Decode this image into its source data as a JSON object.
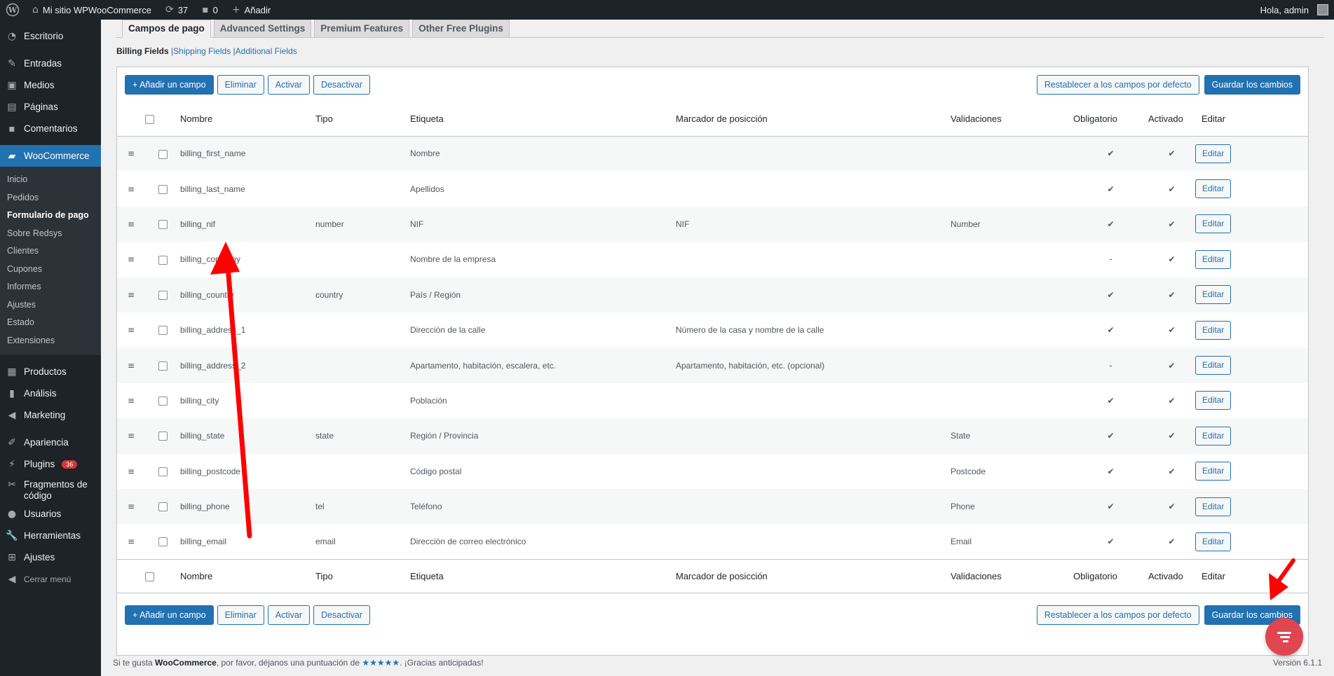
{
  "adminbar": {
    "site_name": "Mi sitio WPWooCommerce",
    "updates": "37",
    "comments": "0",
    "new_label": "Añadir",
    "greeting": "Hola, admin"
  },
  "sidebar": {
    "dashboard": "Escritorio",
    "posts": "Entradas",
    "media": "Medios",
    "pages": "Páginas",
    "comments": "Comentarios",
    "woocommerce": "WooCommerce",
    "woo_sub": [
      "Inicio",
      "Pedidos",
      "Formulario de pago",
      "Sobre Redsys",
      "Clientes",
      "Cupones",
      "Informes",
      "Ajustes",
      "Estado",
      "Extensiones"
    ],
    "products": "Productos",
    "analytics": "Análisis",
    "marketing": "Marketing",
    "appearance": "Apariencia",
    "plugins": "Plugins",
    "plugins_badge": "36",
    "snippets_1": "Fragmentos de",
    "snippets_2": "código",
    "users": "Usuarios",
    "tools": "Herramientas",
    "settings": "Ajustes",
    "collapse": "Cerrar menú"
  },
  "tabs": [
    "Campos de pago",
    "Advanced Settings",
    "Premium Features",
    "Other Free Plugins"
  ],
  "subnav": {
    "billing": "Billing Fields",
    "shipping": "Shipping Fields",
    "additional": "Additional Fields",
    "separator": "|"
  },
  "toolbar": {
    "add": "+ Añadir un campo",
    "delete": "Eliminar",
    "enable": "Activar",
    "disable": "Desactivar",
    "reset": "Restablecer a los campos por defecto",
    "save": "Guardar los cambios"
  },
  "columns": {
    "name": "Nombre",
    "type": "Tipo",
    "label": "Etiqueta",
    "placeholder": "Marcador de posicción",
    "validations": "Validaciones",
    "required": "Obligatorio",
    "enabled": "Activado",
    "edit": "Editar"
  },
  "rows": [
    {
      "name": "billing_first_name",
      "type": "",
      "label": "Nombre",
      "placeholder": "",
      "validation": "",
      "required": "✔",
      "enabled": "✔",
      "edit": "Editar"
    },
    {
      "name": "billing_last_name",
      "type": "",
      "label": "Apellidos",
      "placeholder": "",
      "validation": "",
      "required": "✔",
      "enabled": "✔",
      "edit": "Editar"
    },
    {
      "name": "billing_nif",
      "type": "number",
      "label": "NIF",
      "placeholder": "NIF",
      "validation": "Number",
      "required": "✔",
      "enabled": "✔",
      "edit": "Editar"
    },
    {
      "name": "billing_company",
      "type": "",
      "label": "Nombre de la empresa",
      "placeholder": "",
      "validation": "",
      "required": "-",
      "enabled": "✔",
      "edit": "Editar"
    },
    {
      "name": "billing_country",
      "type": "country",
      "label": "País / Región",
      "placeholder": "",
      "validation": "",
      "required": "✔",
      "enabled": "✔",
      "edit": "Editar"
    },
    {
      "name": "billing_address_1",
      "type": "",
      "label": "Dirección de la calle",
      "placeholder": "Número de la casa y nombre de la calle",
      "validation": "",
      "required": "✔",
      "enabled": "✔",
      "edit": "Editar"
    },
    {
      "name": "billing_address_2",
      "type": "",
      "label": "Apartamento, habitación, escalera, etc.",
      "placeholder": "Apartamento, habitación, etc. (opcional)",
      "validation": "",
      "required": "-",
      "enabled": "✔",
      "edit": "Editar"
    },
    {
      "name": "billing_city",
      "type": "",
      "label": "Población",
      "placeholder": "",
      "validation": "",
      "required": "✔",
      "enabled": "✔",
      "edit": "Editar"
    },
    {
      "name": "billing_state",
      "type": "state",
      "label": "Región / Provincia",
      "placeholder": "",
      "validation": "State",
      "required": "✔",
      "enabled": "✔",
      "edit": "Editar"
    },
    {
      "name": "billing_postcode",
      "type": "",
      "label": "Código postal",
      "placeholder": "",
      "validation": "Postcode",
      "required": "✔",
      "enabled": "✔",
      "edit": "Editar"
    },
    {
      "name": "billing_phone",
      "type": "tel",
      "label": "Teléfono",
      "placeholder": "",
      "validation": "Phone",
      "required": "✔",
      "enabled": "✔",
      "edit": "Editar"
    },
    {
      "name": "billing_email",
      "type": "email",
      "label": "Dirección de correo electrónico",
      "placeholder": "",
      "validation": "Email",
      "required": "✔",
      "enabled": "✔",
      "edit": "Editar"
    }
  ],
  "footer": {
    "pre": "Si te gusta ",
    "brand": "WooCommerce",
    "mid": ", por favor, déjanos una puntuación de ",
    "stars": "★★★★★",
    "post": ". ¡Gracias anticipadas!",
    "version": "Versión 6.1.1"
  },
  "colors": {
    "accent": "#2271b1",
    "sidebar_bg": "#1d2327",
    "annotation_arrow": "#ff0000",
    "fab": "#e0464f"
  }
}
